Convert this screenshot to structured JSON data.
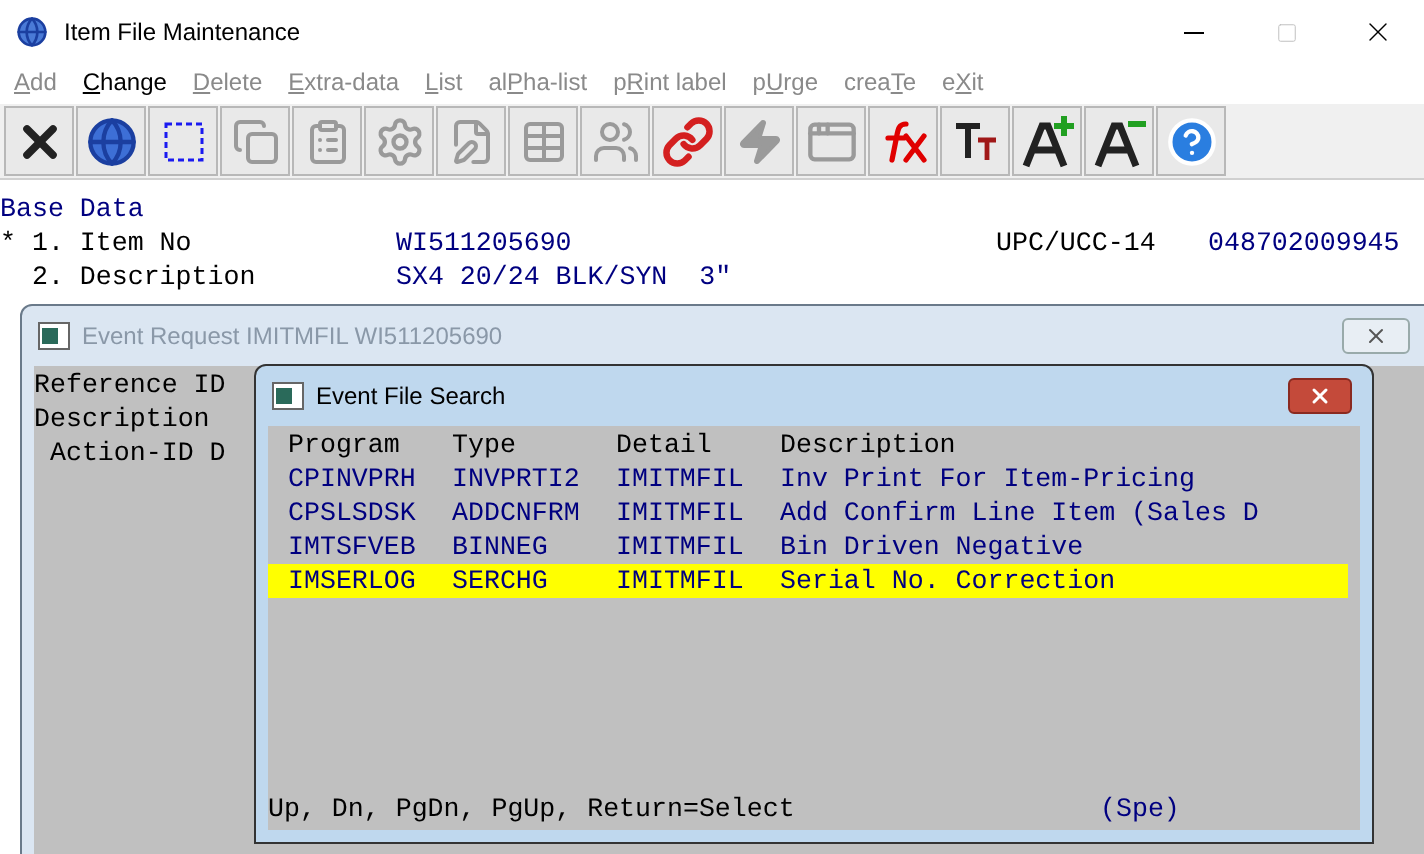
{
  "window": {
    "title": "Item File Maintenance"
  },
  "menu": [
    {
      "key": "A",
      "post": "dd",
      "disabled": true
    },
    {
      "key": "C",
      "post": "hange",
      "disabled": false
    },
    {
      "key": "D",
      "post": "elete",
      "disabled": true
    },
    {
      "key": "E",
      "post": "xtra-data",
      "disabled": true
    },
    {
      "key": "L",
      "post": "ist",
      "disabled": true
    },
    {
      "pre": "al",
      "key": "P",
      "post": "ha-list",
      "disabled": true
    },
    {
      "pre": "p",
      "key": "R",
      "post": "int label",
      "disabled": true
    },
    {
      "pre": "p",
      "key": "U",
      "post": "rge",
      "disabled": true
    },
    {
      "pre": "crea",
      "key": "T",
      "post": "e",
      "disabled": true
    },
    {
      "pre": "e",
      "key": "X",
      "post": "it",
      "disabled": true
    }
  ],
  "toolbar": [
    {
      "kind": "close",
      "disabled": false
    },
    {
      "kind": "globe",
      "disabled": false
    },
    {
      "kind": "select",
      "disabled": false
    },
    {
      "kind": "copy",
      "disabled": true
    },
    {
      "kind": "paste",
      "disabled": true
    },
    {
      "kind": "gear",
      "disabled": true
    },
    {
      "kind": "edit",
      "disabled": true
    },
    {
      "kind": "table",
      "disabled": true
    },
    {
      "kind": "users",
      "disabled": true
    },
    {
      "kind": "link",
      "disabled": false
    },
    {
      "kind": "bolt",
      "disabled": true
    },
    {
      "kind": "window",
      "disabled": true
    },
    {
      "kind": "fx",
      "disabled": false
    },
    {
      "kind": "font",
      "disabled": false
    },
    {
      "kind": "grow",
      "disabled": false
    },
    {
      "kind": "shrink",
      "disabled": false
    },
    {
      "kind": "help",
      "disabled": false
    }
  ],
  "base_data": {
    "heading": "Base Data",
    "fields": [
      {
        "marker": "*",
        "label": "1. Item No",
        "value": "WI511205690",
        "extra_label": "UPC/UCC-14",
        "extra_value": "048702009945"
      },
      {
        "label": "2. Description",
        "value": "SX4 20/24 BLK/SYN  3\""
      }
    ]
  },
  "event_request": {
    "title": "Event Request IMITMFIL WI511205690",
    "lines": [
      "Reference ID",
      "Description",
      " Action-ID D"
    ]
  },
  "event_search": {
    "title": "Event File Search",
    "columns": [
      "Program",
      "Type",
      "Detail",
      "Description"
    ],
    "rows": [
      {
        "cells": [
          "CPINVPRH",
          "INVPRTI2",
          "IMITMFIL",
          "Inv Print For Item-Pricing"
        ],
        "selected": false
      },
      {
        "cells": [
          "CPSLSDSK",
          "ADDCNFRM",
          "IMITMFIL",
          "Add Confirm Line Item (Sales D"
        ],
        "selected": false
      },
      {
        "cells": [
          "IMTSFVEB",
          "BINNEG",
          "IMITMFIL",
          "Bin Driven Negative"
        ],
        "selected": false
      },
      {
        "cells": [
          "IMSERLOG",
          "SERCHG",
          "IMITMFIL",
          "Serial No. Correction"
        ],
        "selected": true
      }
    ],
    "footer": "Up, Dn, PgDn, PgUp, Return=Select",
    "footer_note": "(Spe)"
  }
}
